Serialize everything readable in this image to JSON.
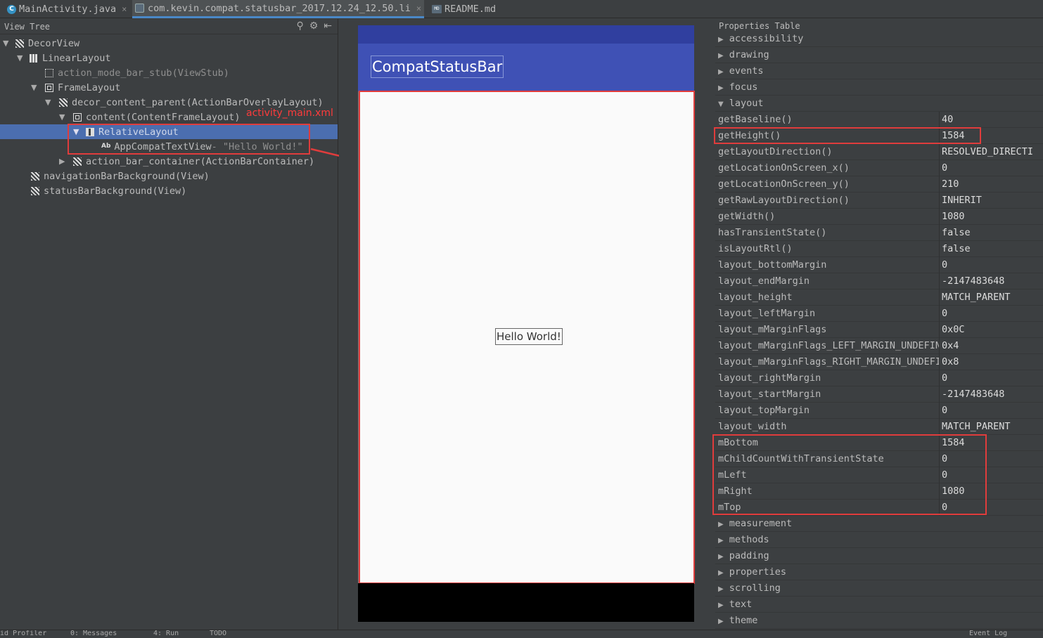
{
  "tabs": [
    {
      "label": "MainActivity.java",
      "icon": "java-class-icon"
    },
    {
      "label": "com.kevin.compat.statusbar_2017.12.24_12.50.li",
      "icon": "layout-inspector-icon"
    },
    {
      "label": "README.md",
      "icon": "markdown-icon"
    }
  ],
  "tree": {
    "title": "View Tree",
    "nodes": [
      {
        "label": "DecorView",
        "sub": ""
      },
      {
        "label": "LinearLayout",
        "sub": ""
      },
      {
        "label": "action_mode_bar_stub",
        "sub": " (ViewStub)"
      },
      {
        "label": "FrameLayout",
        "sub": ""
      },
      {
        "label": "decor_content_parent",
        "sub": " (ActionBarOverlayLayout)"
      },
      {
        "label": "content",
        "sub": " (ContentFrameLayout)"
      },
      {
        "label": "RelativeLayout",
        "sub": ""
      },
      {
        "label": "AppCompatTextView",
        "sub": " - \"Hello World!\""
      },
      {
        "label": "action_bar_container",
        "sub": " (ActionBarContainer)"
      },
      {
        "label": "navigationBarBackground",
        "sub": " (View)"
      },
      {
        "label": "statusBarBackground",
        "sub": " (View)"
      }
    ],
    "annotation": "activity_main.xml"
  },
  "preview": {
    "app_title": "CompatStatusBar",
    "hello_text": "Hello World!"
  },
  "properties": {
    "title": "Properties Table",
    "groups_top": [
      "accessibility",
      "drawing",
      "events",
      "focus",
      "layout"
    ],
    "rows": [
      {
        "k": "getBaseline()",
        "v": "40"
      },
      {
        "k": "getHeight()",
        "v": "1584"
      },
      {
        "k": "getLayoutDirection()",
        "v": "RESOLVED_DIRECTI"
      },
      {
        "k": "getLocationOnScreen_x()",
        "v": "0"
      },
      {
        "k": "getLocationOnScreen_y()",
        "v": "210"
      },
      {
        "k": "getRawLayoutDirection()",
        "v": "INHERIT"
      },
      {
        "k": "getWidth()",
        "v": "1080"
      },
      {
        "k": "hasTransientState()",
        "v": "false"
      },
      {
        "k": "isLayoutRtl()",
        "v": "false"
      },
      {
        "k": "layout_bottomMargin",
        "v": "0"
      },
      {
        "k": "layout_endMargin",
        "v": "-2147483648"
      },
      {
        "k": "layout_height",
        "v": "MATCH_PARENT"
      },
      {
        "k": "layout_leftMargin",
        "v": "0"
      },
      {
        "k": "layout_mMarginFlags",
        "v": "0x0C"
      },
      {
        "k": "layout_mMarginFlags_LEFT_MARGIN_UNDEFINE",
        "v": "0x4"
      },
      {
        "k": "layout_mMarginFlags_RIGHT_MARGIN_UNDEFI",
        "v": "0x8"
      },
      {
        "k": "layout_rightMargin",
        "v": "0"
      },
      {
        "k": "layout_startMargin",
        "v": "-2147483648"
      },
      {
        "k": "layout_topMargin",
        "v": "0"
      },
      {
        "k": "layout_width",
        "v": "MATCH_PARENT"
      },
      {
        "k": "mBottom",
        "v": "1584"
      },
      {
        "k": "mChildCountWithTransientState",
        "v": "0"
      },
      {
        "k": "mLeft",
        "v": "0"
      },
      {
        "k": "mRight",
        "v": "1080"
      },
      {
        "k": "mTop",
        "v": "0"
      }
    ],
    "groups_bottom": [
      "measurement",
      "methods",
      "padding",
      "properties",
      "scrolling",
      "text",
      "theme"
    ]
  },
  "bottom": {
    "items": [
      "id Profiler",
      "0: Messages",
      "4: Run",
      "TODO",
      "Event Log"
    ]
  },
  "colors": {
    "accent_red": "#e03c3c",
    "selection": "#4b6eaf",
    "app_primary": "#3f51b5",
    "app_primary_dark": "#303f9f"
  }
}
